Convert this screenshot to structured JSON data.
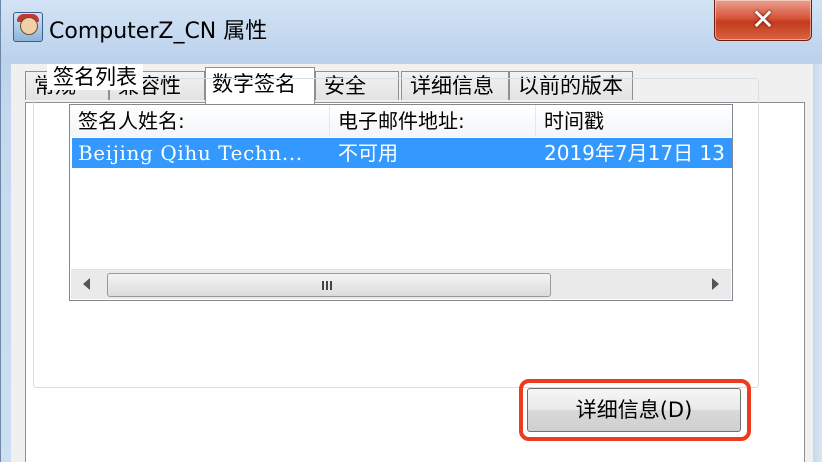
{
  "window": {
    "title": "ComputerZ_CN 属性",
    "close_symbol": "✕"
  },
  "tabs": [
    {
      "label": "常规",
      "active": false
    },
    {
      "label": "兼容性",
      "active": false
    },
    {
      "label": "数字签名",
      "active": true
    },
    {
      "label": "安全",
      "active": false
    },
    {
      "label": "详细信息",
      "active": false
    },
    {
      "label": "以前的版本",
      "active": false
    }
  ],
  "signature_group": {
    "title": "签名列表",
    "columns": [
      "签名人姓名:",
      "电子邮件地址:",
      "时间戳"
    ],
    "rows": [
      {
        "signer": "Beijing Qihu Techn...",
        "email": "不可用",
        "timestamp": "2019年7月17日 13",
        "selected": true
      }
    ]
  },
  "buttons": {
    "details_label": "详细信息(D)"
  },
  "colors": {
    "selection": "#3399ff",
    "highlight_box": "#ee3a1e",
    "close_button": "#c43b1f"
  }
}
